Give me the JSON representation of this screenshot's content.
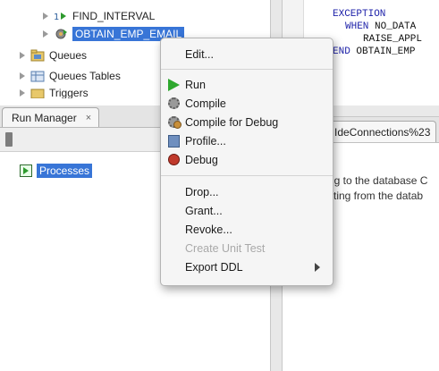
{
  "tree": {
    "items": [
      {
        "label": "FIND_INTERVAL"
      },
      {
        "label": "OBTAIN_EMP_EMAIL"
      },
      {
        "label": "Queues"
      },
      {
        "label": "Queues Tables"
      },
      {
        "label": "Triggers"
      }
    ]
  },
  "run_manager": {
    "tab_label": "Run Manager",
    "tab_close": "×",
    "processes_label": "Processes"
  },
  "code": {
    "line1": "EXCEPTION",
    "line2_kw": "WHEN",
    "line2_rest": " NO_DATA",
    "line3": "RAISE_APPL",
    "line4_kw": "END",
    "line4_rest": " OBTAIN_EMP"
  },
  "log": {
    "tab_label": "IdeConnections%23",
    "line1": "ng to the database C",
    "line2": "cting from the datab"
  },
  "context_menu": {
    "items": [
      {
        "label": "Edit..."
      },
      {
        "label": "Run",
        "icon": "run-icon"
      },
      {
        "label": "Compile",
        "icon": "compile-icon"
      },
      {
        "label": "Compile for Debug",
        "icon": "compile-debug-icon"
      },
      {
        "label": "Profile...",
        "icon": "profile-icon"
      },
      {
        "label": "Debug",
        "icon": "debug-icon"
      },
      {
        "label": "Drop..."
      },
      {
        "label": "Grant..."
      },
      {
        "label": "Revoke..."
      },
      {
        "label": "Create Unit Test",
        "disabled": true
      },
      {
        "label": "Export DDL",
        "submenu": true
      }
    ]
  },
  "colors": {
    "selection": "#3875d7",
    "keyword": "#1b1fa8",
    "run_green": "#2ea82e"
  }
}
